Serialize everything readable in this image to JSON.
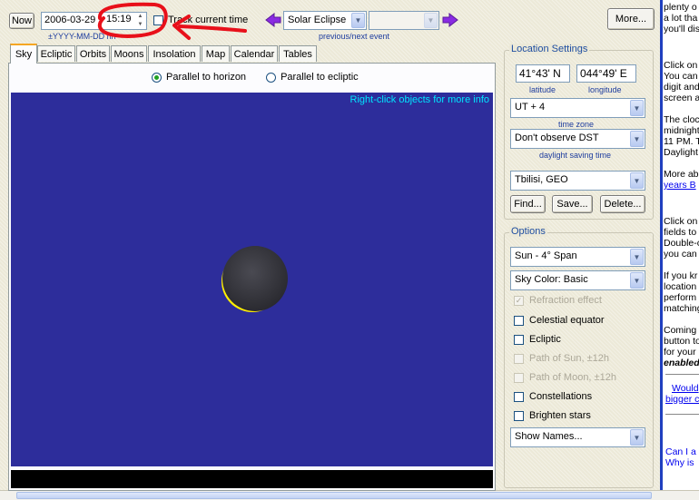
{
  "toolbar": {
    "now_label": "Now",
    "date_value": "2006-03-29",
    "time_value": "15:19",
    "date_hint": "±YYYY-MM-DD hh",
    "track_label": "Track current time",
    "event_selected": "Solar Eclipse",
    "event_hint": "previous/next event",
    "more_label": "More..."
  },
  "tabs": [
    "Sky",
    "Ecliptic",
    "Orbits",
    "Moons",
    "Insolation",
    "Map",
    "Calendar",
    "Tables"
  ],
  "view": {
    "radio_horizon": "Parallel to horizon",
    "radio_ecliptic": "Parallel to ecliptic",
    "hint": "Right-click objects for more info",
    "sky_color": "#2d2d9b",
    "accent_colors": {
      "sun_edge": "#ffef00",
      "annotation": "#e8101a"
    }
  },
  "location": {
    "title": "Location Settings",
    "latitude_value": "41°43'  N",
    "latitude_label": "latitude",
    "longitude_value": "044°49'  E",
    "longitude_label": "longitude",
    "timezone_value": "UT + 4",
    "timezone_label": "time zone",
    "dst_value": "Don't observe DST",
    "dst_label": "daylight saving time",
    "city_value": "Tbilisi, GEO",
    "find_label": "Find...",
    "save_label": "Save...",
    "delete_label": "Delete..."
  },
  "options": {
    "title": "Options",
    "span_value": "Sun - 4° Span",
    "skycolor_value": "Sky Color: Basic",
    "refraction": "Refraction effect",
    "celestial_equator": "Celestial equator",
    "ecliptic": "Ecliptic",
    "path_sun": "Path of Sun, ±12h",
    "path_moon": "Path of Moon, ±12h",
    "constellations": "Constellations",
    "brighten_stars": "Brighten stars",
    "names_value": "Show Names..."
  },
  "side": {
    "l1": "plenty o",
    "l2": "a lot tha",
    "l3": "you'll dis",
    "l4": "Click on",
    "l5": "You can",
    "l6": "digit and",
    "l7": "screen a",
    "l8": "The cloc",
    "l9": "midnight",
    "l10": "11 PM. T",
    "l11": "Daylight",
    "l12": "More abo",
    "l13": "years B",
    "l14": "Click on",
    "l15": "fields to",
    "l16": "Double-c",
    "l17": "you can",
    "l18": "If you kr",
    "l19": "location",
    "l20": "perform",
    "l21": "matching",
    "l22": "Coming",
    "l23": "button to",
    "l24": "for your",
    "l25": "enabled",
    "l26": "Would",
    "l27": "bigger c",
    "l28": "Can I a",
    "l29": "Why is"
  }
}
